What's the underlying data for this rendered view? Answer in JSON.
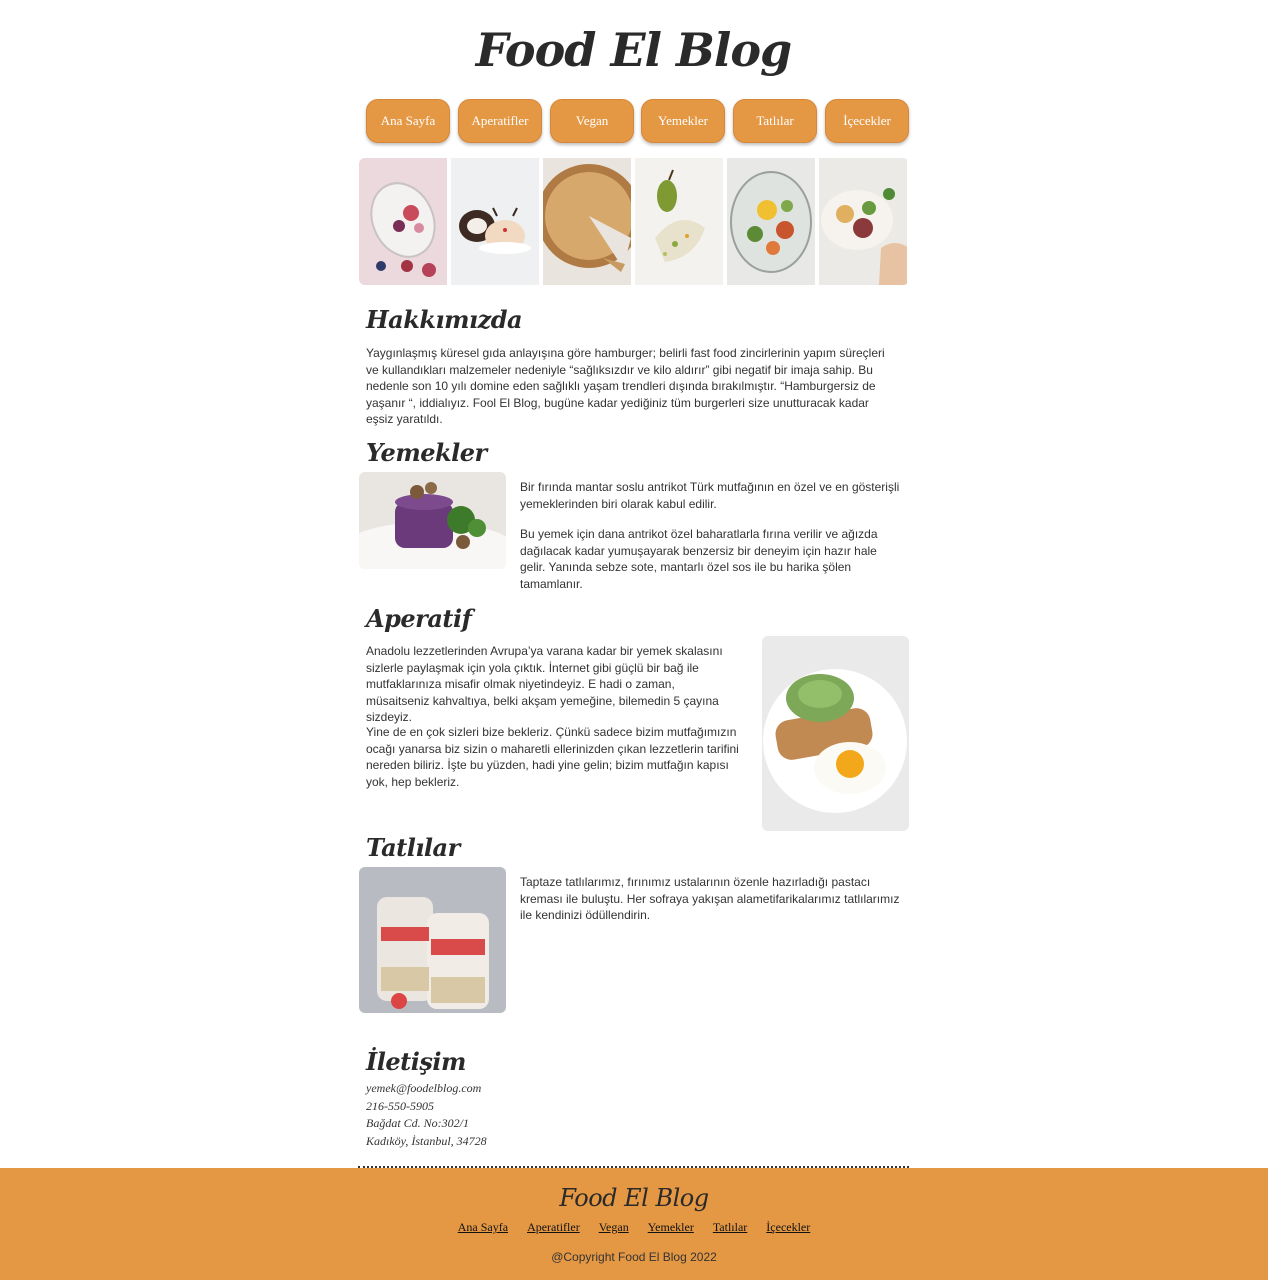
{
  "header": {
    "title": "Food El Blog"
  },
  "nav": {
    "items": [
      {
        "label": "Ana Sayfa"
      },
      {
        "label": "Aperatifler"
      },
      {
        "label": "Vegan"
      },
      {
        "label": "Yemekler"
      },
      {
        "label": "Tatlılar"
      },
      {
        "label": "İçecekler"
      }
    ]
  },
  "colors": {
    "accent": "#e59844",
    "text": "#2b2b2b"
  },
  "about": {
    "heading": "Hakkımızda",
    "text": "Yaygınlaşmış küresel gıda anlayışına göre hamburger; belirli fast food zincirlerinin yapım süreçleri ve kullandıkları malzemeler nedeniyle “sağlıksızdır ve kilo aldırır” gibi negatif bir imaja sahip. Bu nedenle son 10 yılı domine eden sağlıklı yaşam trendleri dışında bırakılmıştır. “Hamburgersiz de yaşanır “, iddialıyız. Fool El Blog, bugüne kadar yediğiniz tüm burgerleri size unutturacak kadar eşsiz yaratıldı."
  },
  "meals": {
    "heading": "Yemekler",
    "p1": "Bir fırında mantar soslu antrikot Türk mutfağının en özel ve en gösterişli yemeklerinden biri olarak kabul edilir.",
    "p2": "Bu yemek için dana antrikot özel baharatlarla fırına verilir ve ağızda dağılacak kadar yumuşayarak benzersiz bir deneyim için hazır hale gelir. Yanında sebze sote, mantarlı özel sos ile bu harika şölen tamamlanır."
  },
  "appetizer": {
    "heading": "Aperatif",
    "p1": "Anadolu lezzetlerinden Avrupa’ya varana kadar bir yemek skalasını sizlerle paylaşmak için yola çıktık. İnternet gibi güçlü bir bağ ile mutfaklarınıza misafir olmak niyetindeyiz. E hadi o zaman, müsaitseniz kahvaltıya, belki akşam yemeğine, bilemedin 5 çayına sizdeyiz.",
    "p2": "Yine de en çok sizleri bize bekleriz. Çünkü sadece bizim mutfağımızın ocağı yanarsa biz sizin o maharetli ellerinizden çıkan lezzetlerin tarifini nereden biliriz. İşte bu yüzden, hadi yine gelin; bizim mutfağın kapısı yok, hep bekleriz."
  },
  "desserts": {
    "heading": "Tatlılar",
    "p1": "Taptaze tatlılarımız, fırınımız ustalarının özenle hazırladığı pastacı kreması ile buluştu. Her sofraya yakışan alametifarikalarımız tatlılarımız ile kendinizi ödüllendirin."
  },
  "contact": {
    "heading": "İletişim",
    "email": "yemek@foodelblog.com",
    "phone": "216-550-5905",
    "address1": "Bağdat Cd. No:302/1",
    "address2": "Kadıköy, İstanbul, 34728"
  },
  "footer": {
    "title": "Food El Blog",
    "links": [
      "Ana Sayfa",
      "Aperatifler",
      "Vegan",
      "Yemekler",
      "Tatlılar",
      "İçecekler"
    ],
    "copyright": "@Copyright Food El Blog 2022"
  }
}
